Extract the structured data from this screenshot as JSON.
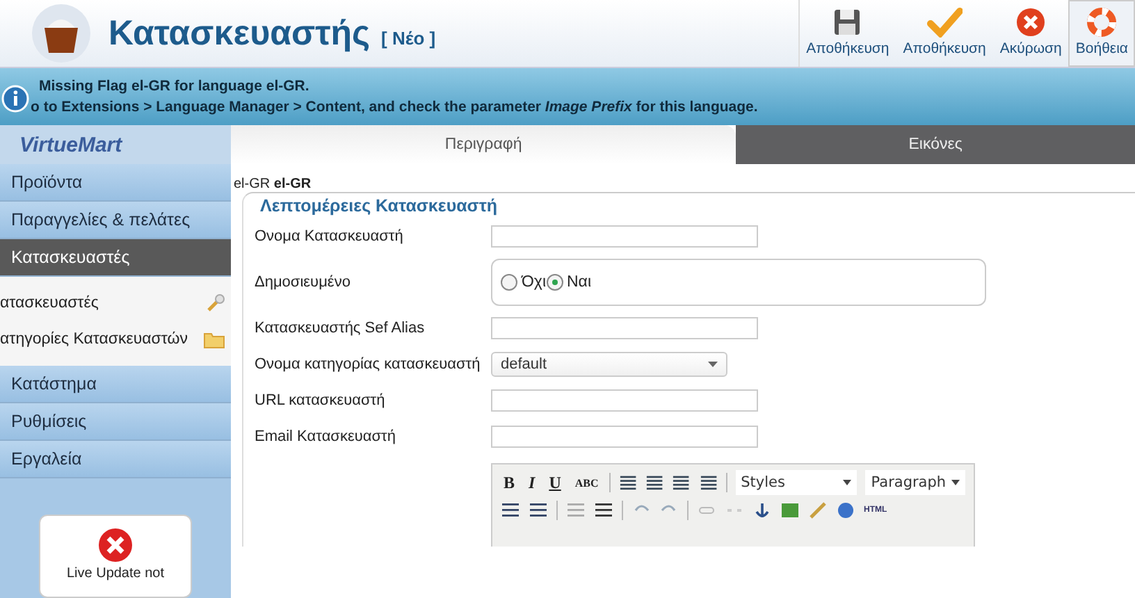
{
  "header": {
    "title": "Κατασκευαστής",
    "badge": "[ Νέο ]"
  },
  "toolbar": [
    {
      "label": "Αποθήκευση",
      "selected": false
    },
    {
      "label": "Αποθήκευση",
      "selected": false
    },
    {
      "label": "Ακύρωση",
      "selected": false
    },
    {
      "label": "Βοήθεια",
      "selected": true
    }
  ],
  "notice": {
    "lines": [
      "Missing Flag el-GR for language el-GR.",
      "o to Extensions > Language Manager > Content, and check the parameter *Image Prefix* for this language."
    ]
  },
  "sidebar": {
    "logo": "VirtueMart",
    "items": [
      {
        "label": "Προϊόντα",
        "selected": false
      },
      {
        "label": "Παραγγελίες & πελάτες",
        "selected": false
      },
      {
        "label": "Κατασκευαστές",
        "selected": true,
        "children": [
          {
            "label": "ατασκευαστές"
          },
          {
            "label": "ατηγορίες Κατασκευαστών"
          }
        ]
      },
      {
        "label": "Κατάστημα",
        "selected": false
      },
      {
        "label": "Ρυθμίσεις",
        "selected": false
      },
      {
        "label": "Εργαλεία",
        "selected": false
      }
    ],
    "update_box": {
      "text": "Live Update not"
    }
  },
  "tabs": [
    {
      "label": "Περιγραφή",
      "selected": true
    },
    {
      "label": "Εικόνες",
      "selected": false
    }
  ],
  "language": "el-GR **el-GR**",
  "fieldset": {
    "legend": "Λεπτομέρειες Κατασκευαστή",
    "fields": [
      {
        "kind": "text",
        "label": "Ονομα Κατασκευαστή"
      },
      {
        "kind": "radio",
        "label": "Δημοσιευμένο",
        "options": [
          {
            "label": "Όχι",
            "selected": false
          },
          {
            "label": "Ναι",
            "selected": true
          }
        ]
      },
      {
        "kind": "text",
        "label": "Κατασκευαστής Sef Alias"
      },
      {
        "kind": "select",
        "label": "Ονομα κατηγορίας κατασκευαστή",
        "value": "default"
      },
      {
        "kind": "text",
        "label": "URL κατασκευαστή"
      },
      {
        "kind": "text",
        "label": "Email Κατασκευαστή"
      }
    ]
  },
  "editor": {
    "format_buttons": [
      "B",
      "I",
      "U",
      "ABC"
    ],
    "styles": "Styles",
    "paragraph": "Paragraph",
    "html_button": "HTML"
  }
}
